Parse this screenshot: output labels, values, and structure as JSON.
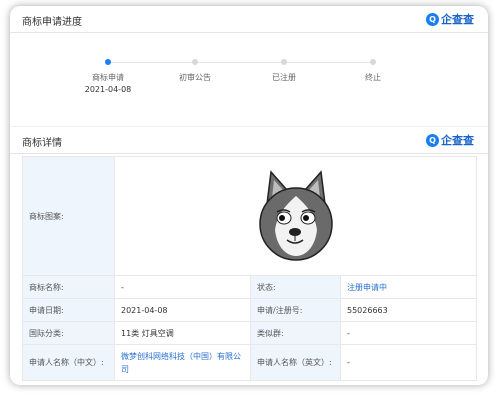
{
  "progress_section": {
    "title": "商标申请进度",
    "brand": "企查查"
  },
  "steps": [
    {
      "label": "商标申请",
      "date": "2021-04-08",
      "active": true
    },
    {
      "label": "初审公告",
      "date": "",
      "active": false
    },
    {
      "label": "已注册",
      "date": "",
      "active": false
    },
    {
      "label": "终止",
      "date": "",
      "active": false
    }
  ],
  "detail_section": {
    "title": "商标详情",
    "brand": "企查查"
  },
  "details": {
    "image_label": "商标图案:",
    "name_label": "商标名称:",
    "name_value": "-",
    "status_label": "状态:",
    "status_value": "注册申请中",
    "date_label": "申请日期:",
    "date_value": "2021-04-08",
    "regno_label": "申请/注册号:",
    "regno_value": "55026663",
    "class_label": "国际分类:",
    "class_value": "11类 灯具空调",
    "similar_label": "类似群:",
    "similar_value": "-",
    "applicant_cn_label": "申请人名称（中文）:",
    "applicant_cn_value": "微梦创科网络科技（中国）有限公司",
    "applicant_en_label": "申请人名称（英文）:",
    "applicant_en_value": "-"
  }
}
